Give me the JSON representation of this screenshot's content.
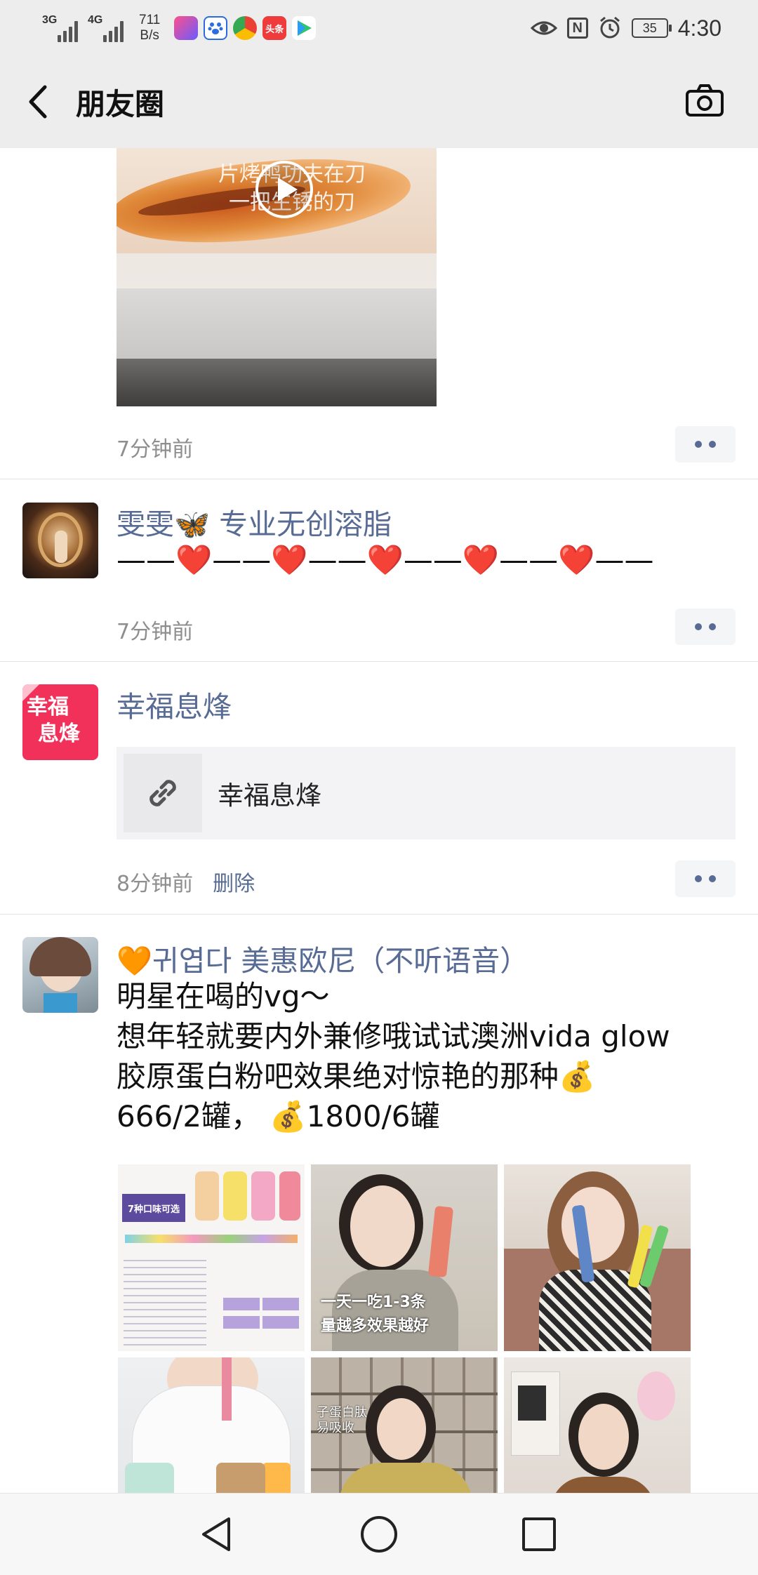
{
  "status_bar": {
    "sim1_label": "3G",
    "sim2_label": "4G",
    "net_speed_value": "711",
    "net_speed_unit": "B/s",
    "app_icons": [
      "video-app-icon",
      "baidu-paw-icon",
      "browser-icon",
      "toutiao-icon",
      "play-store-icon"
    ],
    "toutiao_label": "头条",
    "right_icons": [
      "eye-icon",
      "nfc-icon",
      "alarm-icon"
    ],
    "nfc_label": "N",
    "battery_level": "35",
    "time": "4:30"
  },
  "header": {
    "title": "朋友圈",
    "back_icon": "chevron-left-icon",
    "camera_icon": "camera-icon"
  },
  "posts": [
    {
      "media_type": "video",
      "video_overlay_line1": "片烤鸭功夫在刀",
      "video_overlay_line2": "一把生锈的刀",
      "time": "7分钟前"
    },
    {
      "nickname": "雯雯🦋  专业无创溶脂",
      "text": "——❤️——❤️——❤️——❤️——❤️——",
      "time": "7分钟前"
    },
    {
      "nickname": "幸福息烽",
      "avatar_line1": "幸福",
      "avatar_line2": "息烽",
      "link_title": "幸福息烽",
      "link_icon": "link-icon",
      "time": "8分钟前",
      "delete_label": "删除"
    },
    {
      "nickname": "🧡귀엽다 美惠欧尼（不听语音）",
      "text_lines": [
        "明星在喝的vg～",
        "想年轻就要内外兼修哦试试澳洲vida glow",
        "胶原蛋白粉吧效果绝对惊艳的那种💰",
        "666/2罐， 💰1800/6罐"
      ],
      "image_count": 6,
      "tile1_headline": "7种口味可选",
      "tile2_caption_line1": "一天一吃1-3条",
      "tile2_caption_line2": "量越多效果越好",
      "tile5_caption_line1": "子蛋白肽",
      "tile5_caption_line2": "易吸收"
    }
  ],
  "nav_buttons": [
    "back-triangle-icon",
    "home-circle-icon",
    "recents-square-icon"
  ],
  "colors": {
    "nickname": "#576b95",
    "header_bg": "#ededed",
    "time_text": "#8e8e8e",
    "divider": "#e2e2e2"
  }
}
